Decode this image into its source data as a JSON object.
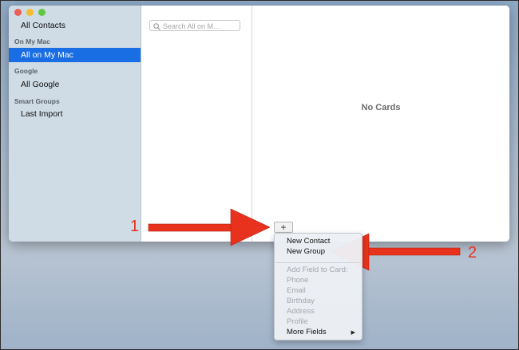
{
  "sidebar": {
    "all_contacts": "All Contacts",
    "section_on_my_mac": "On My Mac",
    "all_on_my_mac": "All on My Mac",
    "section_google": "Google",
    "all_google": "All Google",
    "section_smart_groups": "Smart Groups",
    "last_import": "Last Import"
  },
  "search": {
    "placeholder": "Search All on M..."
  },
  "card_pane": {
    "empty_text": "No Cards"
  },
  "toolbar": {
    "add_label": "+"
  },
  "menu": {
    "new_contact": "New Contact",
    "new_group": "New Group",
    "add_field_header": "Add Field to Card:",
    "phone": "Phone",
    "email": "Email",
    "birthday": "Birthday",
    "address": "Address",
    "profile": "Profile",
    "more_fields": "More Fields"
  },
  "annotations": {
    "step1": "1",
    "step2": "2"
  },
  "colors": {
    "selection": "#1a6ee3",
    "arrow": "#e8321d",
    "sidebar_bg": "#cfdbe5"
  }
}
